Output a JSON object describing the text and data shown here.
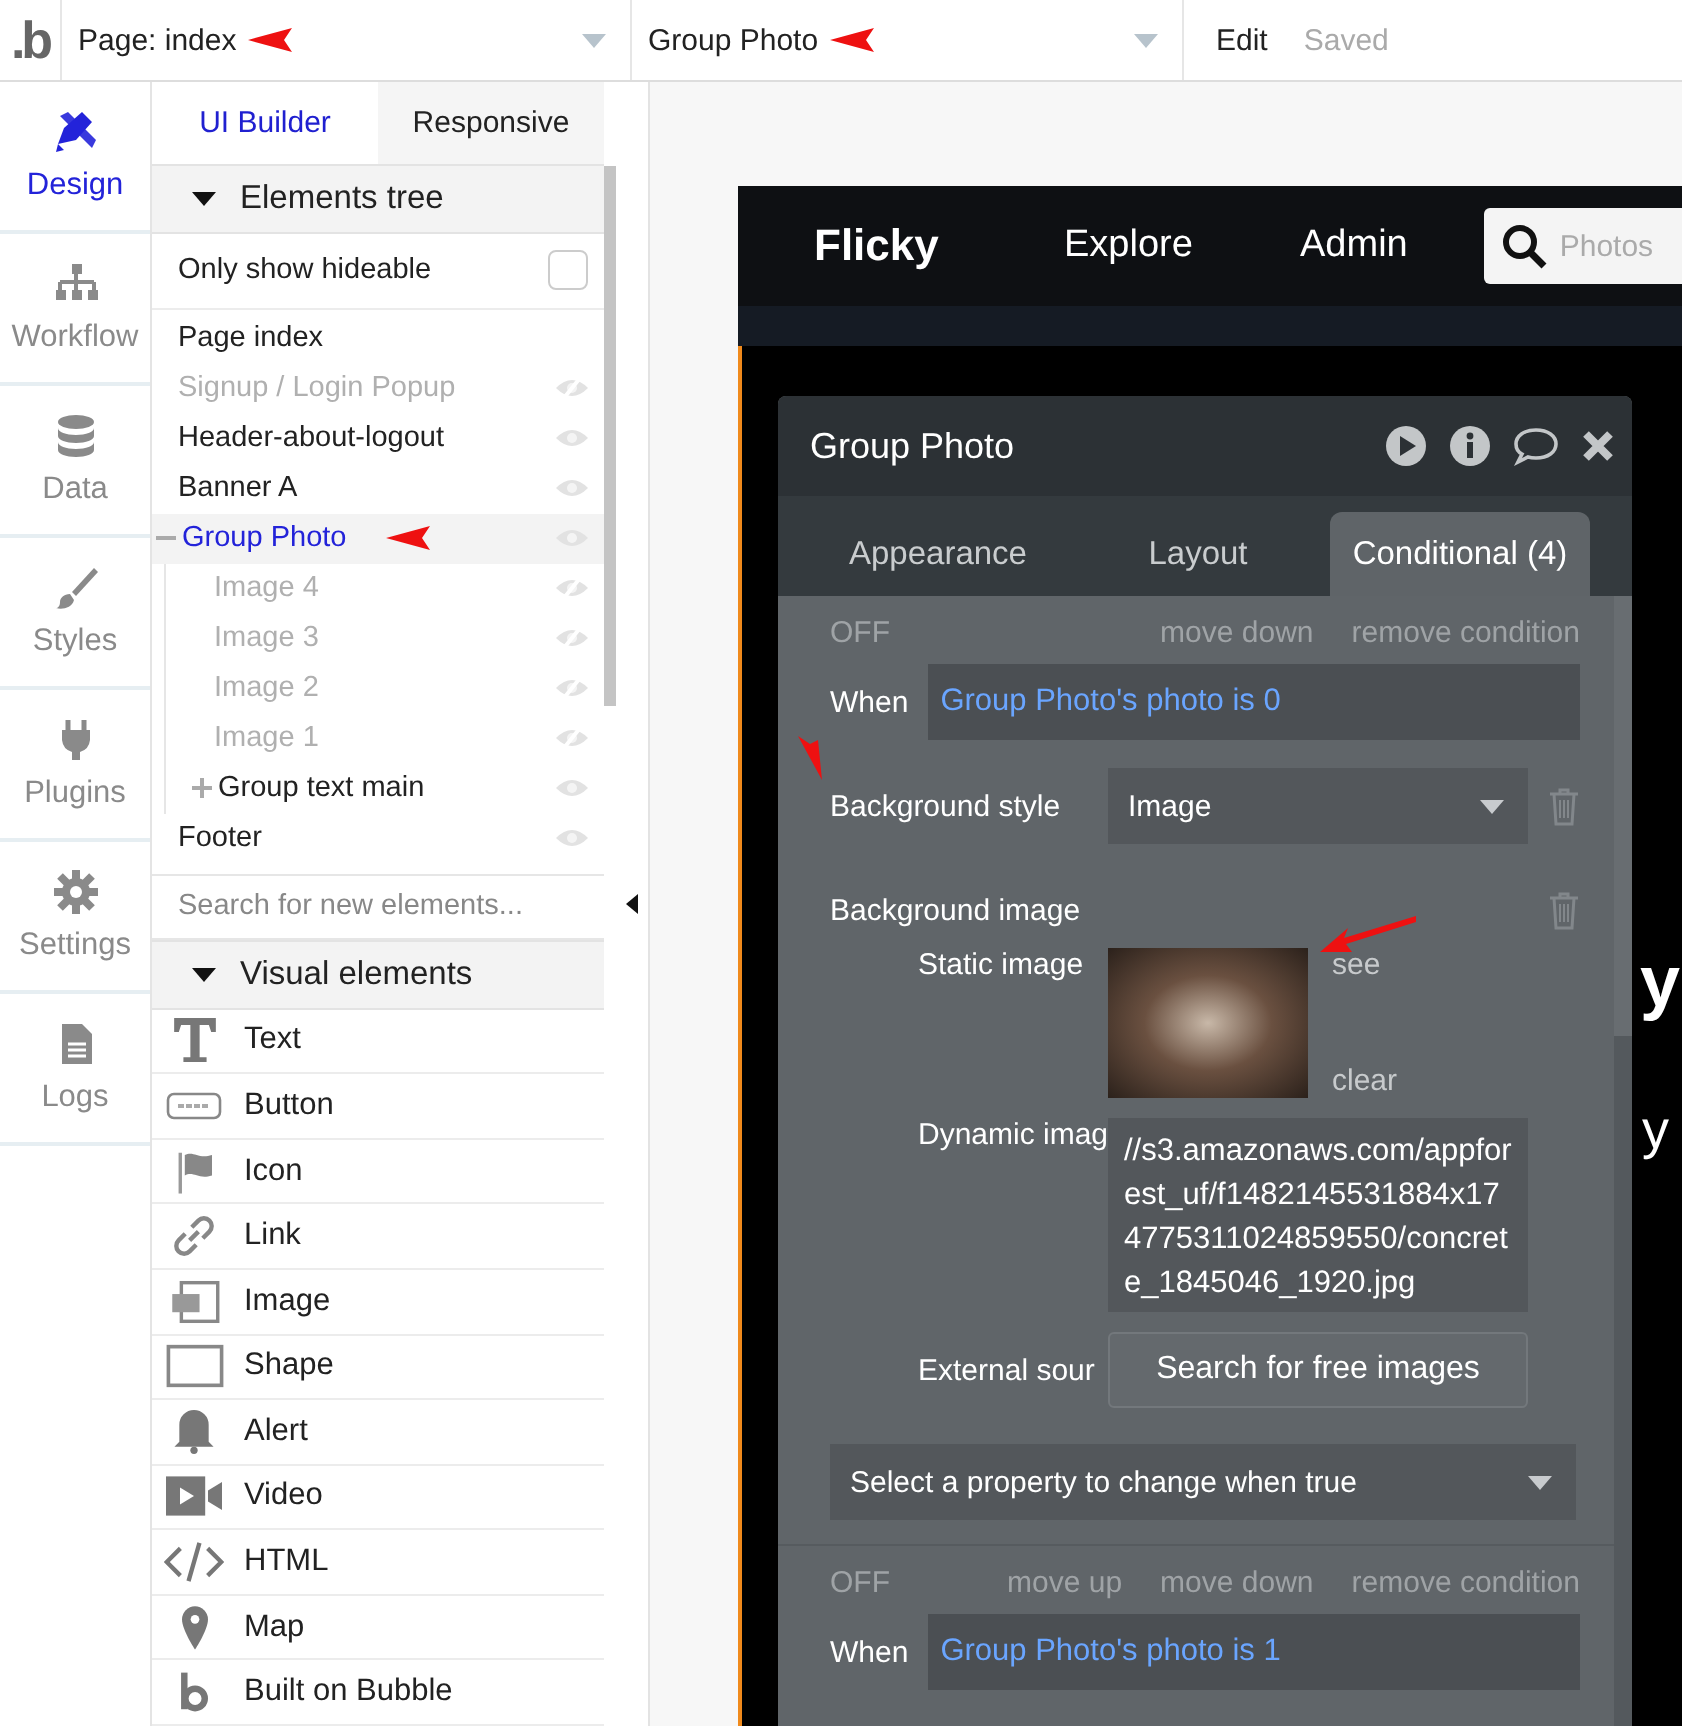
{
  "top_bar": {
    "logo": ".b",
    "page_selector": {
      "value": "Page: index",
      "marked": true
    },
    "element_selector": {
      "value": "Group Photo",
      "marked": true
    },
    "edit": "Edit",
    "status": "Saved"
  },
  "sidebar": {
    "items": [
      {
        "label": "Design",
        "selected": true
      },
      {
        "label": "Workflow",
        "selected": false
      },
      {
        "label": "Data",
        "selected": false
      },
      {
        "label": "Styles",
        "selected": false
      },
      {
        "label": "Plugins",
        "selected": false
      },
      {
        "label": "Settings",
        "selected": false
      },
      {
        "label": "Logs",
        "selected": false
      }
    ]
  },
  "panel": {
    "tabs": [
      {
        "label": "UI Builder",
        "selected": true
      },
      {
        "label": "Responsive",
        "selected": false
      }
    ],
    "elements_tree": {
      "title": "Elements tree",
      "expanded": true,
      "filter": {
        "label": "Only show hideable",
        "checked": false
      },
      "items": [
        {
          "label": "Page index",
          "kind": "page",
          "hidden": false,
          "selected": false
        },
        {
          "label": "Signup / Login Popup",
          "kind": "element",
          "hidden": true,
          "selected": false
        },
        {
          "label": "Header-about-logout",
          "kind": "element",
          "hidden": false,
          "selected": false
        },
        {
          "label": "Banner A",
          "kind": "element",
          "hidden": false,
          "selected": false
        },
        {
          "label": "Group Photo",
          "kind": "element",
          "hidden": false,
          "selected": true,
          "marked": true,
          "expanded": true,
          "children": [
            {
              "label": "Image 4",
              "kind": "element",
              "hidden": true,
              "selected": false
            },
            {
              "label": "Image 3",
              "kind": "element",
              "hidden": true,
              "selected": false
            },
            {
              "label": "Image 2",
              "kind": "element",
              "hidden": true,
              "selected": false
            },
            {
              "label": "Image 1",
              "kind": "element",
              "hidden": true,
              "selected": false
            },
            {
              "label": "Group text main",
              "kind": "element",
              "hidden": false,
              "selected": false,
              "expanded": false
            }
          ]
        },
        {
          "label": "Footer",
          "kind": "element",
          "hidden": false,
          "selected": false
        }
      ]
    },
    "search": {
      "placeholder": "Search for new elements..."
    },
    "visual_elements": {
      "title": "Visual elements",
      "expanded": true,
      "items": [
        {
          "label": "Text"
        },
        {
          "label": "Button"
        },
        {
          "label": "Icon"
        },
        {
          "label": "Link"
        },
        {
          "label": "Image"
        },
        {
          "label": "Shape"
        },
        {
          "label": "Alert"
        },
        {
          "label": "Video"
        },
        {
          "label": "HTML"
        },
        {
          "label": "Map"
        },
        {
          "label": "Built on Bubble"
        }
      ]
    }
  },
  "preview": {
    "brand": "Flicky",
    "nav": [
      "Explore",
      "Admin"
    ],
    "search_placeholder": "Photos",
    "hero_text": [
      "y",
      "y"
    ]
  },
  "property_editor": {
    "title": "Group Photo",
    "tabs": [
      {
        "label": "Appearance",
        "selected": false
      },
      {
        "label": "Layout",
        "selected": false
      },
      {
        "label": "Conditional (4)",
        "selected": true
      }
    ],
    "conditions": [
      {
        "state": "OFF",
        "actions": [
          "move down",
          "remove condition"
        ],
        "when_label": "When",
        "when": "Group Photo's photo is 0",
        "properties": [
          {
            "kind": "dropdown",
            "label": "Background style",
            "value": "Image",
            "marked": true
          },
          {
            "kind": "image",
            "label": "Background image",
            "static_label": "Static image",
            "see": "see",
            "clear": "clear",
            "see_marked": true,
            "dynamic_label": "Dynamic imag",
            "dynamic_value": "//s3.amazonaws.com/appforest_uf/f1482145531884x174775311024859550/concrete_1845046_1920.jpg",
            "external_label": "External sour",
            "external_button": "Search for free images"
          }
        ],
        "add_property": "Select a property to change when true"
      },
      {
        "state": "OFF",
        "actions": [
          "move up",
          "move down",
          "remove condition"
        ],
        "when_label": "When",
        "when": "Group Photo's photo is 1"
      }
    ]
  }
}
